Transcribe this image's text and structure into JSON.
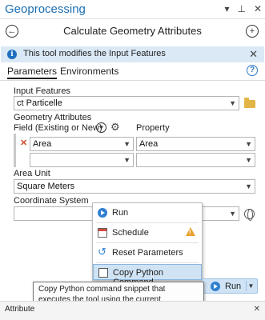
{
  "window": {
    "title": "Geoprocessing"
  },
  "tool": {
    "title": "Calculate Geometry Attributes"
  },
  "info": {
    "message": "This tool modifies the Input Features"
  },
  "tabs": {
    "parameters": "Parameters",
    "environments": "Environments"
  },
  "input_features": {
    "label": "Input Features",
    "value": "ct Particelle"
  },
  "geometry_attributes": {
    "label": "Geometry Attributes",
    "field_header": "Field (Existing or New)",
    "property_header": "Property",
    "rows": [
      {
        "field": "Area",
        "property": "Area"
      },
      {
        "field": "",
        "property": ""
      }
    ]
  },
  "area_unit": {
    "label": "Area Unit",
    "value": "Square Meters"
  },
  "coordinate_system": {
    "label": "Coordinate System",
    "value": ""
  },
  "run_menu": {
    "items": [
      {
        "label": "Run",
        "icon": "run-icon"
      },
      {
        "label": "Schedule",
        "icon": "calendar-icon"
      },
      {
        "label": "Reset Parameters",
        "icon": "reset-icon"
      },
      {
        "label": "Copy Python Command",
        "icon": "copy-icon"
      }
    ]
  },
  "tooltip": {
    "text": "Copy Python command snippet that executes the tool using the current parameters and environments."
  },
  "run_button": {
    "label": "Run"
  },
  "bottom": {
    "text": "Attribute"
  },
  "colors": {
    "accent": "#1c6fb3",
    "info_bg": "#dbe9f7",
    "highlight": "#cfe3f5",
    "warning": "#e8a22b",
    "error": "#d04a2a"
  }
}
